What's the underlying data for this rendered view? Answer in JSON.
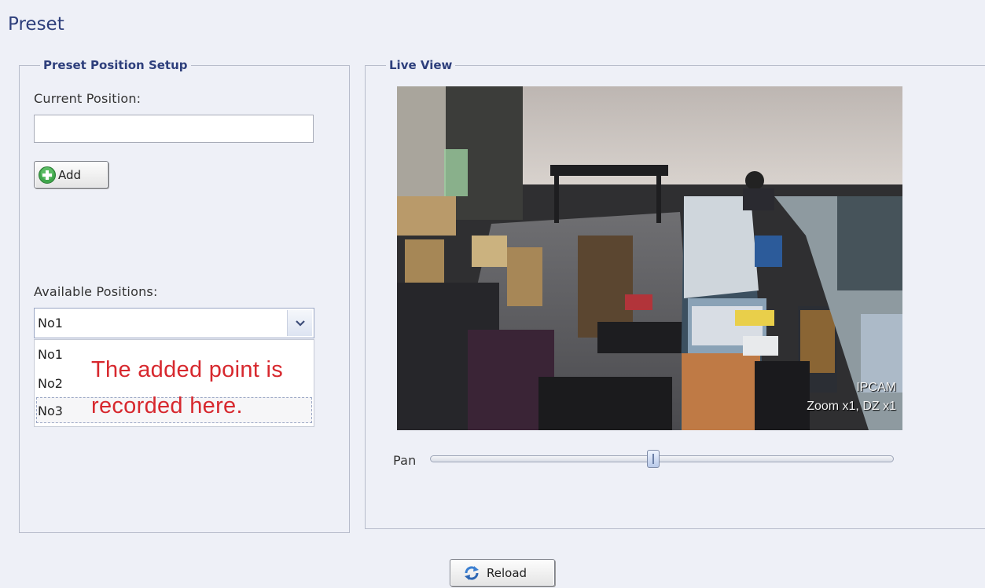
{
  "page": {
    "title": "Preset"
  },
  "setup": {
    "legend": "Preset Position Setup",
    "current_position_label": "Current Position:",
    "current_position_value": "",
    "add_label": "Add",
    "available_positions_label": "Available Positions:",
    "selected_position": "No1",
    "options": [
      "No1",
      "No2",
      "No3"
    ],
    "annotation_line1": "The added point is",
    "annotation_line2": "recorded here.",
    "annotation_color": "#d7282e"
  },
  "live": {
    "legend": "Live View",
    "osd_camera": "IPCAM",
    "osd_zoom": "Zoom x1, DZ x1",
    "pan_label": "Pan",
    "pan_value": 0.48
  },
  "footer": {
    "reload_label": "Reload"
  },
  "icons": {
    "add": "plus-circle-icon",
    "reload": "refresh-icon",
    "dropdown": "chevron-down-icon"
  },
  "colors": {
    "title": "#2e3f7c",
    "background": "#eef0f7",
    "accent": "#2e3f7c"
  }
}
